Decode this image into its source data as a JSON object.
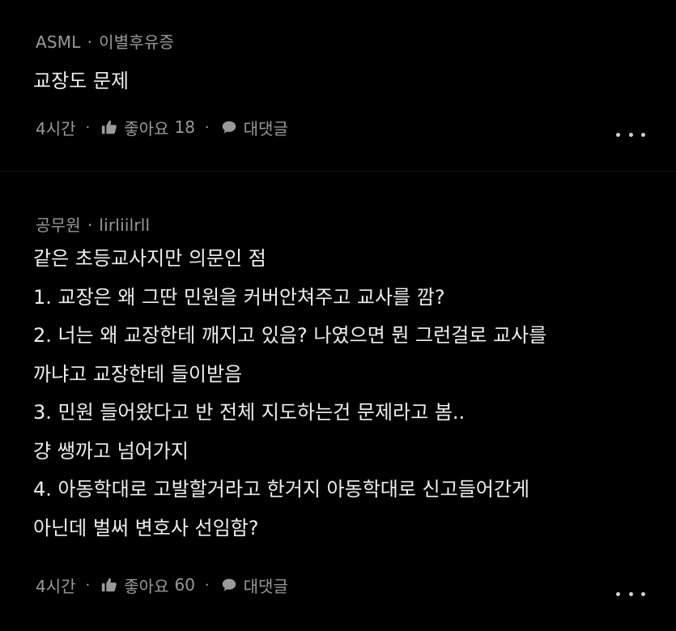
{
  "comments": [
    {
      "author": "ASML",
      "separator": "·",
      "tag": "이별후유증",
      "lines": [
        "교장도 문제"
      ],
      "time": "4시간",
      "like_label": "좋아요",
      "like_count": "18",
      "reply_label": "대댓글",
      "icons": {
        "like": "thumbs-up-icon",
        "reply": "speech-bubble-icon",
        "more": "more-options-icon"
      }
    },
    {
      "author": "공무원",
      "separator": "·",
      "tag": "lirliilrll",
      "lines": [
        "같은 초등교사지만 의문인 점",
        "1. 교장은 왜 그딴 민원을 커버안쳐주고 교사를 깜?",
        "2. 너는 왜 교장한테 깨지고 있음? 나였으면 뭔 그런걸로 교사를",
        "까냐고 교장한테 들이받음",
        "3. 민원 들어왔다고 반 전체 지도하는건 문제라고 봄..",
        "걍 쌩까고 넘어가지",
        "4. 아동학대로 고발할거라고 한거지 아동학대로 신고들어간게",
        "아닌데 벌써 변호사 선임함?"
      ],
      "time": "4시간",
      "like_label": "좋아요",
      "like_count": "60",
      "reply_label": "대댓글",
      "icons": {
        "like": "thumbs-up-icon",
        "reply": "speech-bubble-icon",
        "more": "more-options-icon"
      }
    }
  ],
  "colors": {
    "background": "#000000",
    "text": "#eeeeee",
    "muted": "#9a9a9a"
  }
}
